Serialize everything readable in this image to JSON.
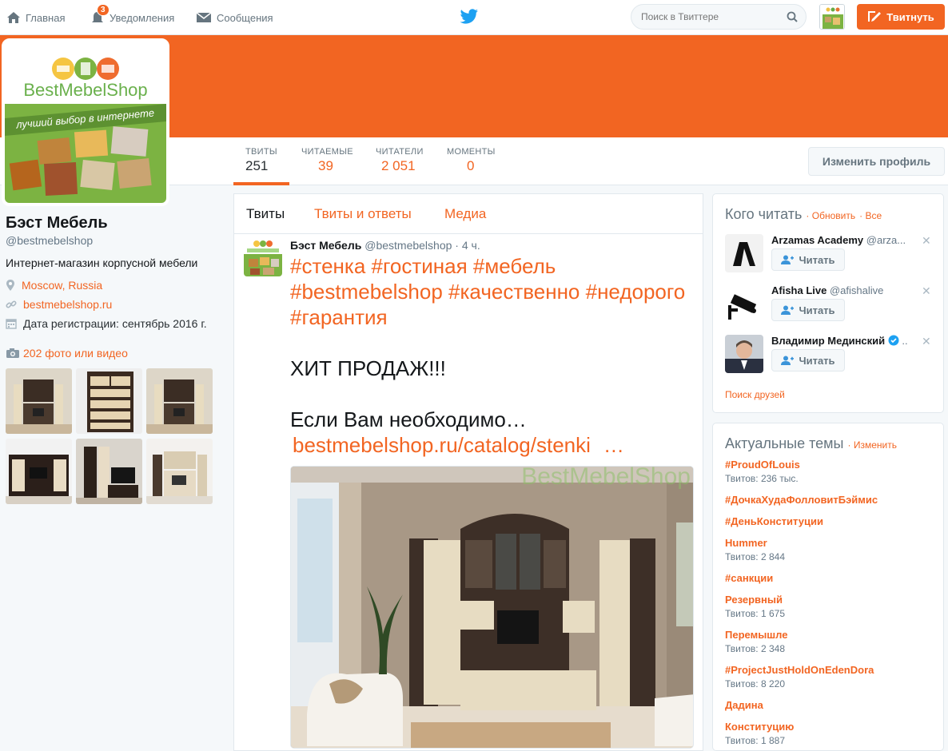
{
  "nav": {
    "home": "Главная",
    "notifications": "Уведомления",
    "notifications_count": "3",
    "messages": "Сообщения",
    "search_placeholder": "Поиск в Твиттере",
    "tweet_button": "Твитнуть"
  },
  "profile": {
    "logo_text": "BestMebelShop",
    "logo_tagline": "лучший выбор в интернете",
    "name": "Бэст Мебель",
    "handle": "@bestmebelshop",
    "bio": "Интернет-магазин корпусной мебели",
    "location": "Moscow, Russia",
    "website": "bestmebelshop.ru",
    "joined": "Дата регистрации: сентябрь 2016 г.",
    "media_link": "202 фото или видео",
    "edit_button": "Изменить профиль"
  },
  "stats": [
    {
      "label": "ТВИТЫ",
      "value": "251"
    },
    {
      "label": "ЧИТАЕМЫЕ",
      "value": "39"
    },
    {
      "label": "ЧИТАТЕЛИ",
      "value": "2 051"
    },
    {
      "label": "МОМЕНТЫ",
      "value": "0"
    }
  ],
  "timeline": {
    "tabs": [
      "Твиты",
      "Твиты и ответы",
      "Медиа"
    ],
    "tweet": {
      "name": "Бэст Мебель",
      "handle": "@bestmebelshop",
      "time": "4 ч.",
      "hashtags_line1": "#стенка #гостиная #мебель",
      "hashtags_line2": "#bestmebelshop #качественно #недорого",
      "hashtags_line3": "#гарантия",
      "text_line1": "ХИТ ПРОДАЖ!!!",
      "text_line2": "Если Вам необходимо…",
      "link": "bestmebelshop.ru/catalog/stenki",
      "link_more": "…",
      "image_watermark": "BestMebelShop"
    }
  },
  "who_to_follow": {
    "title": "Кого читать",
    "refresh": "Обновить",
    "all": "Все",
    "follow_label": "Читать",
    "find_friends": "Поиск друзей",
    "items": [
      {
        "name": "Arzamas Academy",
        "handle": "@arza..."
      },
      {
        "name": "Afisha Live",
        "handle": "@afishalive"
      },
      {
        "name": "Владимир Мединский",
        "handle": "..."
      }
    ]
  },
  "trends": {
    "title": "Актуальные темы",
    "change": "Изменить",
    "items": [
      {
        "name": "#ProudOfLouis",
        "count": "Твитов: 236 тыс."
      },
      {
        "name": "#ДочкаХудаФолловитБэймис",
        "count": ""
      },
      {
        "name": "#ДеньКонституции",
        "count": ""
      },
      {
        "name": "Hummer",
        "count": "Твитов: 2 844"
      },
      {
        "name": "#санкции",
        "count": ""
      },
      {
        "name": "Резервный",
        "count": "Твитов: 1 675"
      },
      {
        "name": "Перемышле",
        "count": "Твитов: 2 348"
      },
      {
        "name": "#ProjectJustHoldOnEdenDora",
        "count": "Твитов: 8 220"
      },
      {
        "name": "Дадина",
        "count": ""
      },
      {
        "name": "Конституцию",
        "count": "Твитов: 1 887"
      }
    ]
  },
  "colors": {
    "accent": "#f26522",
    "text": "#14171a",
    "muted": "#657786"
  }
}
